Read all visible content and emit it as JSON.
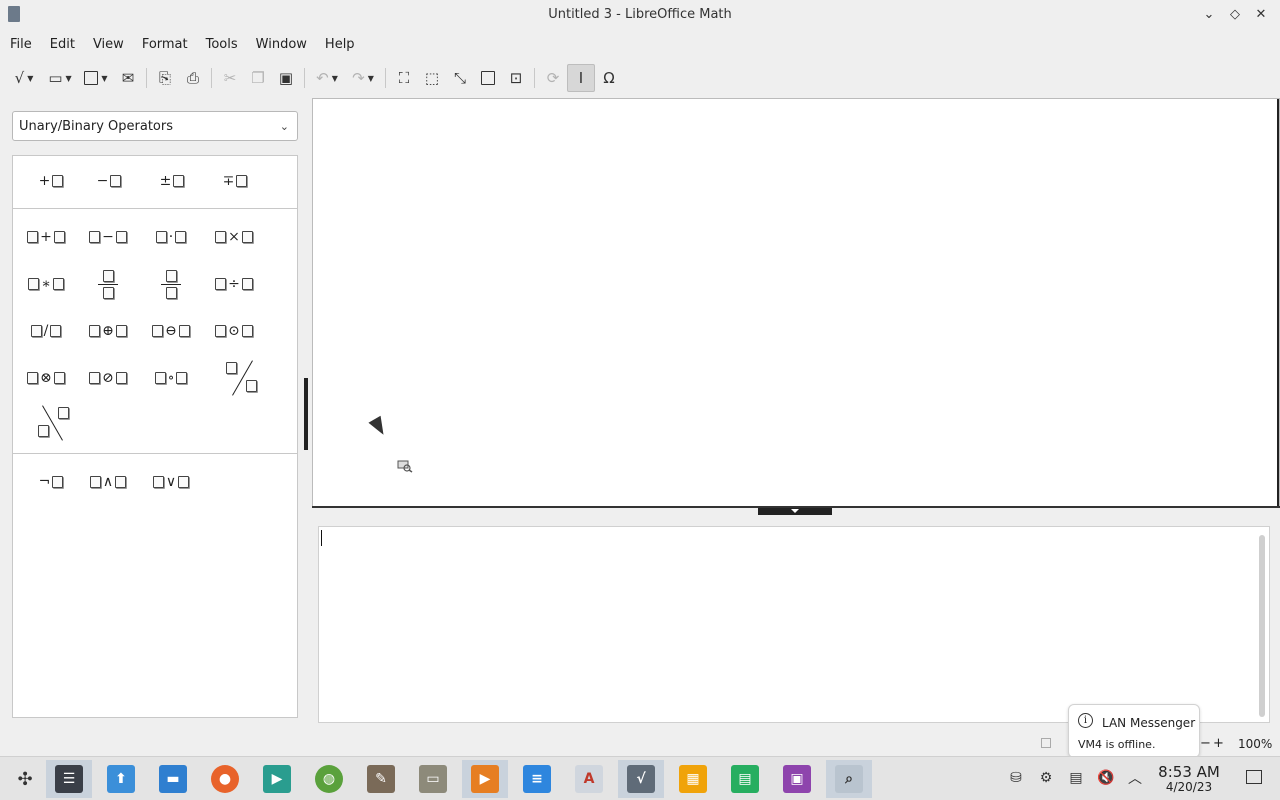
{
  "window": {
    "title": "Untitled 3 - LibreOffice Math",
    "controls": [
      "chevron-down",
      "restore",
      "close"
    ]
  },
  "menu": [
    "File",
    "Edit",
    "View",
    "Format",
    "Tools",
    "Window",
    "Help"
  ],
  "toolbar": {
    "buttons": [
      "formula-new",
      "open",
      "save",
      "export",
      "update",
      "print",
      "cut",
      "copy",
      "paste",
      "undo",
      "redo",
      "zoom-in",
      "zoom-out",
      "show-all",
      "zoom-100",
      "fit",
      "auto-refresh",
      "formula-cursor",
      "symbols"
    ],
    "symbols_glyph": "Ω"
  },
  "sidebar": {
    "category_select": "Unary/Binary Operators",
    "unary": [
      {
        "op": "+"
      },
      {
        "op": "−"
      },
      {
        "op": "±"
      },
      {
        "op": "∓"
      }
    ],
    "binary_row1": [
      {
        "op": "+"
      },
      {
        "op": "−"
      },
      {
        "op": "·"
      },
      {
        "op": "×"
      }
    ],
    "binary_row2_first": {
      "op": "∗"
    },
    "binary_row2_last": {
      "op": "÷"
    },
    "binary_row3": [
      {
        "op": "/"
      },
      {
        "op": "⊕"
      },
      {
        "op": "⊖"
      },
      {
        "op": "⊙"
      }
    ],
    "binary_row4": [
      {
        "op": "⊗"
      },
      {
        "op": "⊘"
      },
      {
        "op": "∘"
      }
    ],
    "logic": [
      {
        "op": "¬"
      },
      {
        "op": "∧"
      },
      {
        "op": "∨"
      }
    ]
  },
  "statusbar": {
    "zoom_minus": "−",
    "zoom_plus": "+",
    "zoom": "100%"
  },
  "notification": {
    "icon": "i",
    "title": "LAN Messenger",
    "body": "VM4 is offline."
  },
  "taskbar": {
    "time": "8:53 AM",
    "date": "4/20/23"
  }
}
